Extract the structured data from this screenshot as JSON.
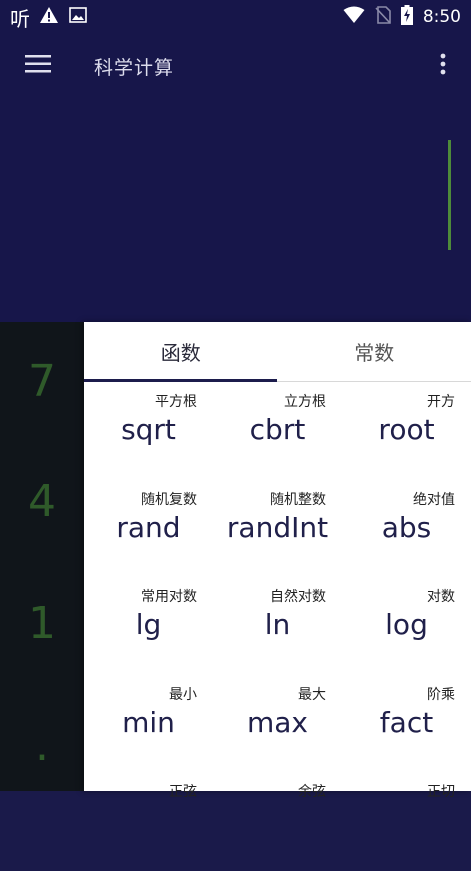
{
  "status_bar": {
    "app_glyph": "听",
    "time": "8:50"
  },
  "app_bar": {
    "title": "科学计算"
  },
  "keypad_left": {
    "digits": [
      "7",
      "4",
      "1",
      "."
    ]
  },
  "tabs": [
    {
      "label": "函数",
      "active": true
    },
    {
      "label": "常数",
      "active": false
    }
  ],
  "functions": [
    {
      "hint": "平方根",
      "name": "sqrt"
    },
    {
      "hint": "立方根",
      "name": "cbrt"
    },
    {
      "hint": "开方",
      "name": "root"
    },
    {
      "hint": "随机复数",
      "name": "rand"
    },
    {
      "hint": "随机整数",
      "name": "randInt"
    },
    {
      "hint": "绝对值",
      "name": "abs"
    },
    {
      "hint": "常用对数",
      "name": "lg"
    },
    {
      "hint": "自然对数",
      "name": "ln"
    },
    {
      "hint": "对数",
      "name": "log"
    },
    {
      "hint": "最小",
      "name": "min"
    },
    {
      "hint": "最大",
      "name": "max"
    },
    {
      "hint": "阶乘",
      "name": "fact"
    },
    {
      "hint": "正弦",
      "name": ""
    },
    {
      "hint": "余弦",
      "name": ""
    },
    {
      "hint": "正切",
      "name": ""
    }
  ],
  "colors": {
    "primary": "#17164a",
    "cursor": "#4d8b3a",
    "digit": "#2f5a2a",
    "keypad_bg": "#10151a"
  }
}
